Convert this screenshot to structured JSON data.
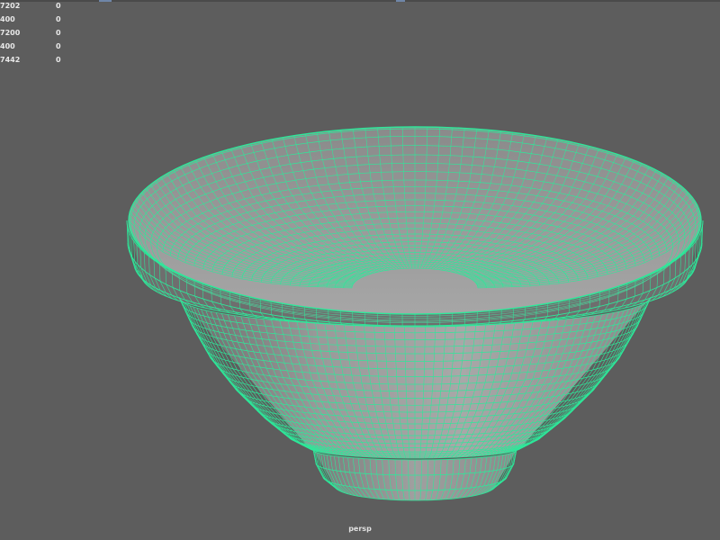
{
  "viewport": {
    "camera_label": "persp",
    "background_color": "#5d5d5d",
    "wireframe_color": "#2ee89a"
  },
  "hud": {
    "rows": [
      {
        "value": "7202",
        "count": "0"
      },
      {
        "value": "400",
        "count": "0"
      },
      {
        "value": "7200",
        "count": "0"
      },
      {
        "value": "400",
        "count": "0"
      },
      {
        "value": "7442",
        "count": "0"
      }
    ]
  },
  "scene": {
    "object": "bowl-mesh",
    "display_mode": "wireframe-on-shaded"
  }
}
